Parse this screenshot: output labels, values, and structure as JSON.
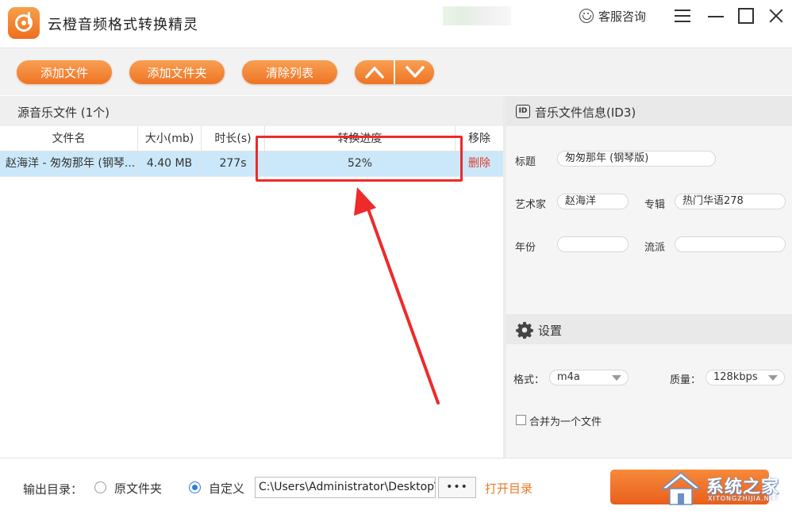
{
  "app": {
    "title": "云橙音频格式转换精灵",
    "service": "客服咨询"
  },
  "toolbar": {
    "add_file": "添加文件",
    "add_folder": "添加文件夹",
    "clear_list": "清除列表"
  },
  "file_list": {
    "header": "源音乐文件 (1个)",
    "columns": [
      "文件名",
      "大小(mb)",
      "时长(s)",
      "转换进度",
      "移除"
    ],
    "rows": [
      {
        "name": "赵海洋 - 匆匆那年 (钢琴...",
        "size": "4.40 MB",
        "duration": "277s",
        "progress": "52%",
        "remove": "删除"
      }
    ]
  },
  "id3": {
    "header": "音乐文件信息(ID3)",
    "id_badge": "ID",
    "title_label": "标题",
    "title_value": "匆匆那年 (钢琴版)",
    "artist_label": "艺术家",
    "artist_value": "赵海洋",
    "album_label": "专辑",
    "album_value": "热门华语278",
    "year_label": "年份",
    "year_value": "",
    "genre_label": "流派",
    "genre_value": ""
  },
  "settings": {
    "header": "设置",
    "format_label": "格式：",
    "format_value": "m4a",
    "quality_label": "质量：",
    "quality_value": "128kbps",
    "merge_label": "合并为一个文件"
  },
  "output": {
    "label": "输出目录：",
    "option_original": "原文件夹",
    "option_custom": "自定义",
    "path": "C:\\Users\\Administrator\\Desktop\\",
    "browse": "•••",
    "open_dir": "打开目录"
  },
  "watermark": {
    "text": "系统之家",
    "sub": "XITONGZHIJIA.NET"
  },
  "colors": {
    "accent": "#ef7425",
    "selection": "#cbe8fa",
    "annotation": "#ee2a2a",
    "remove": "#e23a2a",
    "radio": "#2b7de1"
  }
}
